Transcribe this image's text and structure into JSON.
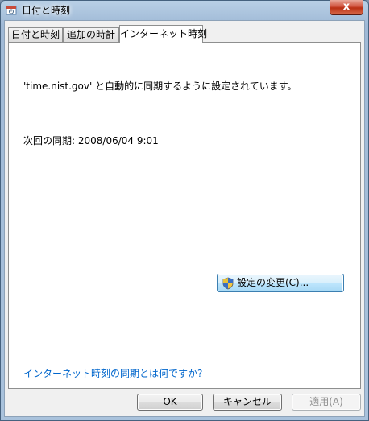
{
  "window": {
    "title": "日付と時刻",
    "close_label": "x"
  },
  "tabs": [
    {
      "label": "日付と時刻"
    },
    {
      "label": "追加の時計"
    },
    {
      "label": "インターネット時刻"
    }
  ],
  "panel": {
    "sync_message": "'time.nist.gov' と自動的に同期するように設定されています。",
    "next_sync": "次回の同期: 2008/06/04 9:01",
    "change_settings_label": "設定の変更(C)...",
    "help_link": "インターネット時刻の同期とは何ですか?"
  },
  "footer": {
    "ok_label": "OK",
    "cancel_label": "キャンセル",
    "apply_label": "適用(A)"
  }
}
